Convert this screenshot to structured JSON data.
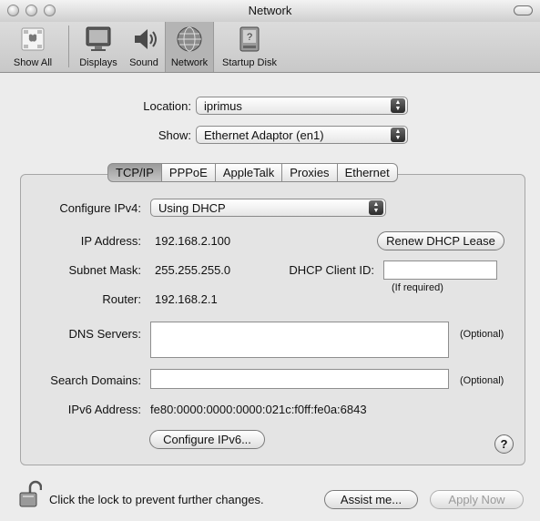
{
  "window": {
    "title": "Network"
  },
  "toolbar": {
    "items": [
      {
        "label": "Show All",
        "icon": "apple-grid-icon"
      },
      {
        "label": "Displays",
        "icon": "display-icon"
      },
      {
        "label": "Sound",
        "icon": "speaker-icon"
      },
      {
        "label": "Network",
        "icon": "network-globe-icon",
        "selected": true
      },
      {
        "label": "Startup Disk",
        "icon": "hard-disk-icon"
      }
    ]
  },
  "location": {
    "label": "Location:",
    "value": "iprimus"
  },
  "show": {
    "label": "Show:",
    "value": "Ethernet Adaptor (en1)"
  },
  "tabs": [
    "TCP/IP",
    "PPPoE",
    "AppleTalk",
    "Proxies",
    "Ethernet"
  ],
  "tcpip": {
    "configure_label": "Configure IPv4:",
    "configure_value": "Using DHCP",
    "ip_label": "IP Address:",
    "ip_value": "192.168.2.100",
    "renew_button": "Renew DHCP Lease",
    "subnet_label": "Subnet Mask:",
    "subnet_value": "255.255.255.0",
    "client_id_label": "DHCP Client ID:",
    "client_id_value": "",
    "client_id_hint": "(If required)",
    "router_label": "Router:",
    "router_value": "192.168.2.1",
    "dns_label": "DNS Servers:",
    "dns_value": "",
    "dns_optional": "(Optional)",
    "search_label": "Search Domains:",
    "search_value": "",
    "search_optional": "(Optional)",
    "ipv6_label": "IPv6 Address:",
    "ipv6_value": "fe80:0000:0000:0000:021c:f0ff:fe0a:6843",
    "configure_ipv6_button": "Configure IPv6...",
    "help": "?"
  },
  "footer": {
    "lock_text": "Click the lock to prevent further changes.",
    "assist_button": "Assist me...",
    "apply_button": "Apply Now"
  }
}
